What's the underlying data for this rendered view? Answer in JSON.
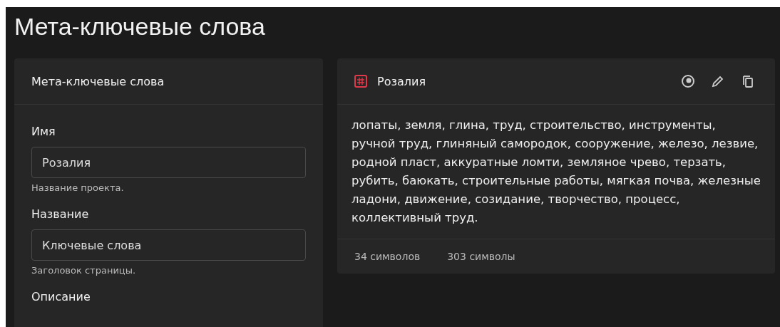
{
  "page_title": "Мета-ключевые слова",
  "form_card": {
    "title": "Мета-ключевые слова",
    "fields": [
      {
        "label": "Имя",
        "value": "Розалия",
        "hint": "Название проекта."
      },
      {
        "label": "Название",
        "value": "Ключевые слова",
        "hint": "Заголовок страницы."
      },
      {
        "label": "Описание"
      }
    ]
  },
  "preview_card": {
    "title": "Розалия",
    "keywords": "лопаты, земля, глина, труд, строительство, инструменты, ручной труд, глиняный самородок, сооружение, железо, лезвие, родной пласт, аккуратные ломти, земляное чрево, терзать, рубить, баюкать, строительные работы, мягкая почва, железные ладони, движение, созидание, творчество, процесс, коллективный труд.",
    "counts": [
      "34 символов",
      "303 символы"
    ]
  }
}
